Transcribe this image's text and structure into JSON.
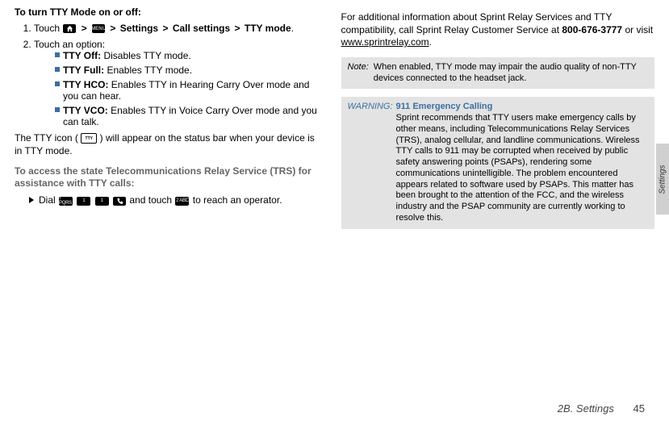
{
  "left": {
    "heading": "To turn TTY Mode on or off:",
    "step1": {
      "lead": "Touch ",
      "menu_icon_text": "MENU",
      "s1": "Settings",
      "s2": "Call settings",
      "s3": "TTY mode",
      "tail": "."
    },
    "step2": "Touch an option:",
    "opts": {
      "off_label": "TTY Off:",
      "off_text": " Disables TTY mode.",
      "full_label": "TTY Full:",
      "full_text": " Enables TTY mode.",
      "hco_label": "TTY HCO:",
      "hco_text": " Enables TTY in Hearing Carry Over mode and you can hear.",
      "vco_label": "TTY VCO:",
      "vco_text": " Enables TTY in Voice Carry Over mode and you can talk."
    },
    "tty_para_a": "The TTY icon (",
    "tty_badge": "TTY",
    "tty_para_b": ") will appear on the status bar when your device is in TTY mode.",
    "subhead": "To access the state Telecommunications Relay Service (TRS) for assistance with TTY calls:",
    "dial": {
      "lead": "Dial ",
      "k1": "7 PQRS",
      "k2": "1",
      "k3": "1",
      "mid": " and touch ",
      "k4": "2 ABC",
      "tail": " to reach an operator."
    }
  },
  "right": {
    "para_a": "For additional information about Sprint Relay Services and TTY compatibility, call Sprint Relay Customer Service at ",
    "phone": "800-676-3777",
    "para_b": " or visit ",
    "url": "www.sprintrelay.com",
    "para_c": ".",
    "note_label": "Note:",
    "note_text": "When enabled, TTY mode may impair the audio quality of non-TTY devices connected to the headset jack.",
    "warn_label": "WARNING:",
    "warn_title": "911 Emergency Calling",
    "warn_text": "Sprint recommends that TTY users make emergency calls by other means, including Telecommunications Relay Services (TRS), analog cellular, and landline communications. Wireless TTY calls to 911 may be corrupted when received by public safety answering points (PSAPs), rendering some communications unintelligible. The problem encountered appears related to software used by PSAPs. This matter has been brought to the attention of the FCC, and the wireless industry and the PSAP community are currently working to resolve this."
  },
  "side_tab": "Settings",
  "footer": {
    "section": "2B. Settings",
    "page": "45"
  }
}
